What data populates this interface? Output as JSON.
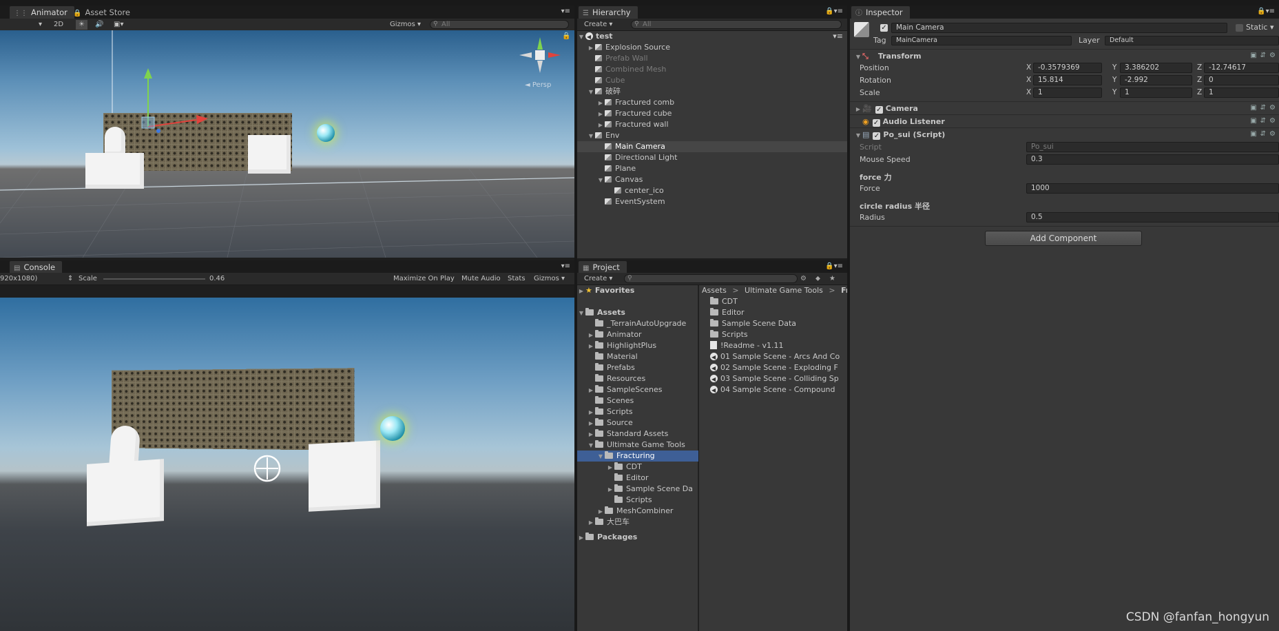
{
  "scene_panel": {
    "tabs": [
      {
        "label": "Animator",
        "icon": "animator-icon"
      },
      {
        "label": "Asset Store",
        "icon": "asset-store-icon"
      }
    ],
    "toolbar": {
      "mode_2d": "2D",
      "gizmos": "Gizmos ▾",
      "search_placeholder": "All"
    },
    "gizmo_label": "◄ Persp"
  },
  "console_panel": {
    "tab_label": "Console",
    "resolution": "920x1080)",
    "scale_label": "Scale",
    "scale_value": "0.46",
    "buttons": [
      "Maximize On Play",
      "Mute Audio",
      "Stats",
      "Gizmos ▾"
    ]
  },
  "hierarchy": {
    "tab_label": "Hierarchy",
    "create_label": "Create ▾",
    "search_placeholder": "All",
    "scene_name": "test",
    "items": [
      {
        "label": "Explosion Source",
        "depth": 1,
        "arrow": "▶",
        "dim": false
      },
      {
        "label": "Prefab Wall",
        "depth": 1,
        "arrow": "",
        "dim": true
      },
      {
        "label": "Combined Mesh",
        "depth": 1,
        "arrow": "",
        "dim": true
      },
      {
        "label": "Cube",
        "depth": 1,
        "arrow": "",
        "dim": true
      },
      {
        "label": "破碎",
        "depth": 1,
        "arrow": "▼",
        "dim": false
      },
      {
        "label": "Fractured comb",
        "depth": 2,
        "arrow": "▶",
        "dim": false
      },
      {
        "label": "Fractured cube",
        "depth": 2,
        "arrow": "▶",
        "dim": false
      },
      {
        "label": "Fractured wall",
        "depth": 2,
        "arrow": "▶",
        "dim": false
      },
      {
        "label": "Env",
        "depth": 1,
        "arrow": "▼",
        "dim": false
      },
      {
        "label": "Main Camera",
        "depth": 2,
        "arrow": "",
        "dim": false,
        "highlight": true
      },
      {
        "label": "Directional Light",
        "depth": 2,
        "arrow": "",
        "dim": false
      },
      {
        "label": "Plane",
        "depth": 2,
        "arrow": "",
        "dim": false
      },
      {
        "label": "Canvas",
        "depth": 2,
        "arrow": "▼",
        "dim": false
      },
      {
        "label": "center_ico",
        "depth": 3,
        "arrow": "",
        "dim": false
      },
      {
        "label": "EventSystem",
        "depth": 2,
        "arrow": "",
        "dim": false
      }
    ]
  },
  "project": {
    "tab_label": "Project",
    "create_label": "Create ▾",
    "favorites_label": "Favorites",
    "assets_label": "Assets",
    "packages_label": "Packages",
    "tree": [
      {
        "label": "_TerrainAutoUpgrade",
        "depth": 1,
        "arrow": ""
      },
      {
        "label": "Animator",
        "depth": 1,
        "arrow": "▶"
      },
      {
        "label": "HighlightPlus",
        "depth": 1,
        "arrow": "▶"
      },
      {
        "label": "Material",
        "depth": 1,
        "arrow": ""
      },
      {
        "label": "Prefabs",
        "depth": 1,
        "arrow": ""
      },
      {
        "label": "Resources",
        "depth": 1,
        "arrow": ""
      },
      {
        "label": "SampleScenes",
        "depth": 1,
        "arrow": "▶"
      },
      {
        "label": "Scenes",
        "depth": 1,
        "arrow": ""
      },
      {
        "label": "Scripts",
        "depth": 1,
        "arrow": "▶"
      },
      {
        "label": "Source",
        "depth": 1,
        "arrow": "▶"
      },
      {
        "label": "Standard Assets",
        "depth": 1,
        "arrow": "▶"
      },
      {
        "label": "Ultimate Game Tools",
        "depth": 1,
        "arrow": "▼"
      },
      {
        "label": "Fracturing",
        "depth": 2,
        "arrow": "▼",
        "selected": true
      },
      {
        "label": "CDT",
        "depth": 3,
        "arrow": "▶"
      },
      {
        "label": "Editor",
        "depth": 3,
        "arrow": ""
      },
      {
        "label": "Sample Scene Da",
        "depth": 3,
        "arrow": "▶"
      },
      {
        "label": "Scripts",
        "depth": 3,
        "arrow": ""
      },
      {
        "label": "MeshCombiner",
        "depth": 2,
        "arrow": "▶"
      },
      {
        "label": "大巴车",
        "depth": 1,
        "arrow": "▶"
      }
    ],
    "breadcrumb": [
      "Assets",
      "Ultimate Game Tools",
      "Fr"
    ],
    "files": [
      {
        "label": "CDT",
        "type": "folder"
      },
      {
        "label": "Editor",
        "type": "folder"
      },
      {
        "label": "Sample Scene Data",
        "type": "folder"
      },
      {
        "label": "Scripts",
        "type": "folder"
      },
      {
        "label": "!Readme - v1.11",
        "type": "doc"
      },
      {
        "label": "01 Sample Scene - Arcs And Co",
        "type": "scene"
      },
      {
        "label": "02 Sample Scene - Exploding F",
        "type": "scene"
      },
      {
        "label": "03 Sample Scene - Colliding Sp",
        "type": "scene"
      },
      {
        "label": "04 Sample Scene - Compound",
        "type": "scene"
      }
    ]
  },
  "inspector": {
    "tab_label": "Inspector",
    "object_name": "Main Camera",
    "static_label": "Static ▾",
    "tag_label": "Tag",
    "tag_value": "MainCamera",
    "layer_label": "Layer",
    "layer_value": "Default",
    "transform": {
      "title": "Transform",
      "position_label": "Position",
      "rotation_label": "Rotation",
      "scale_label": "Scale",
      "position": {
        "x": "-0.3579369",
        "y": "3.386202",
        "z": "-12.74617"
      },
      "rotation": {
        "x": "15.814",
        "y": "-2.992",
        "z": "0"
      },
      "scale": {
        "x": "1",
        "y": "1",
        "z": "1"
      }
    },
    "components": [
      "Camera",
      "Audio Listener",
      "Po_sui (Script)"
    ],
    "script": {
      "script_label": "Script",
      "script_value": "Po_sui",
      "mouse_speed_label": "Mouse Speed",
      "mouse_speed_value": "0.3",
      "force_header": "force 力",
      "force_label": "Force",
      "force_value": "1000",
      "radius_header": "circle  radius 半径",
      "radius_label": "Radius",
      "radius_value": "0.5"
    },
    "add_component_label": "Add Component"
  },
  "watermark": "CSDN @fanfan_hongyun"
}
